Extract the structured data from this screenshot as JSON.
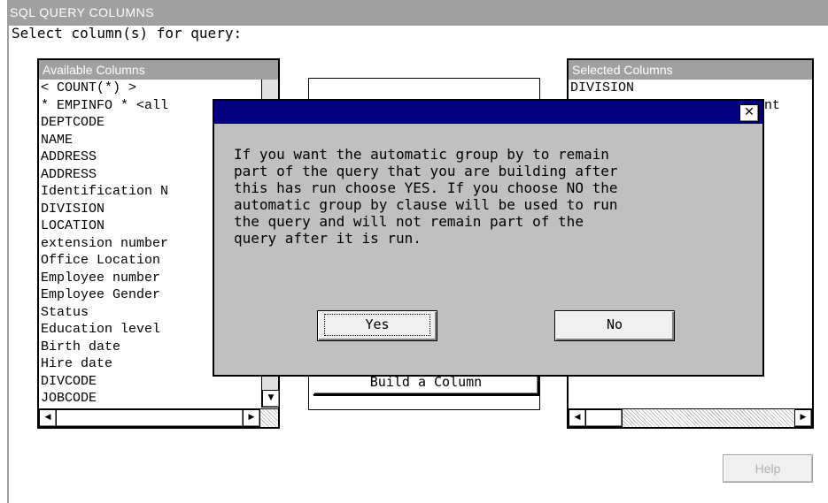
{
  "window": {
    "title": "SQL QUERY COLUMNS",
    "prompt": "Select column(s) for query:"
  },
  "available": {
    "header": "Available Columns",
    "items": [
      "< COUNT(*) >",
      "* EMPINFO * <all",
      "DEPTCODE",
      "NAME",
      "ADDRESS",
      "ADDRESS",
      "Identification N",
      "DIVISION",
      "LOCATION",
      "extension number",
      "Office Location",
      "Employee number",
      "Employee Gender",
      "Status",
      "Education level",
      "Birth date",
      "Hire date",
      "DIVCODE",
      "JOBCODE"
    ]
  },
  "selected": {
    "header": "Selected Columns",
    "items": [
      "DIVISION",
      "unt"
    ]
  },
  "center": {
    "build_label": "Build a Column"
  },
  "help": {
    "label": "Help"
  },
  "dialog": {
    "close_glyph": "✕",
    "message": [
      "If you want the automatic group by to remain",
      "part of the query that you are building after",
      "this has run choose YES. If you choose NO the",
      "automatic group by clause will be used to run",
      "the query and will not remain part of the",
      "query after it is run."
    ],
    "yes_label": "Yes",
    "no_label": "No"
  },
  "icons": {
    "scroll_up": "▲",
    "scroll_down": "▼",
    "scroll_left": "◀",
    "scroll_right": "▶"
  }
}
